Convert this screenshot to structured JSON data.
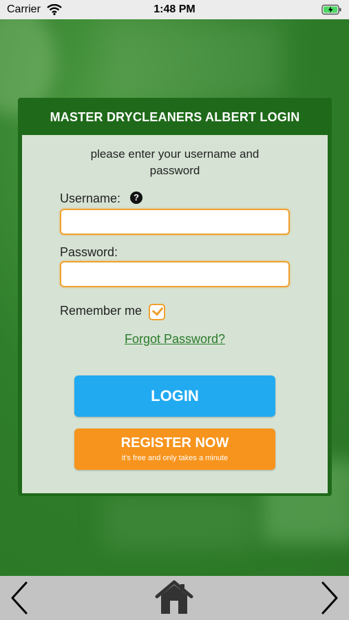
{
  "status_bar": {
    "carrier": "Carrier",
    "time": "1:48 PM"
  },
  "login_card": {
    "title": "MASTER DRYCLEANERS ALBERT LOGIN",
    "instructions": "please enter your username and password",
    "username_label": "Username:",
    "password_label": "Password:",
    "remember_label": "Remember me",
    "remember_checked": true,
    "forgot_link": "Forgot Password?",
    "login_button": "LOGIN",
    "register_button": "REGISTER NOW",
    "register_subtext": "it's free and only takes a minute",
    "username_value": "",
    "password_value": ""
  },
  "bottom_nav": {
    "icons": [
      "chevron-left-icon",
      "home-icon",
      "chevron-right-icon"
    ]
  },
  "colors": {
    "header_green": "#1f6a1a",
    "input_border": "#f0a030",
    "login_blue": "#22aaf0",
    "register_orange": "#f7941d",
    "link_green": "#2a7a2a"
  }
}
